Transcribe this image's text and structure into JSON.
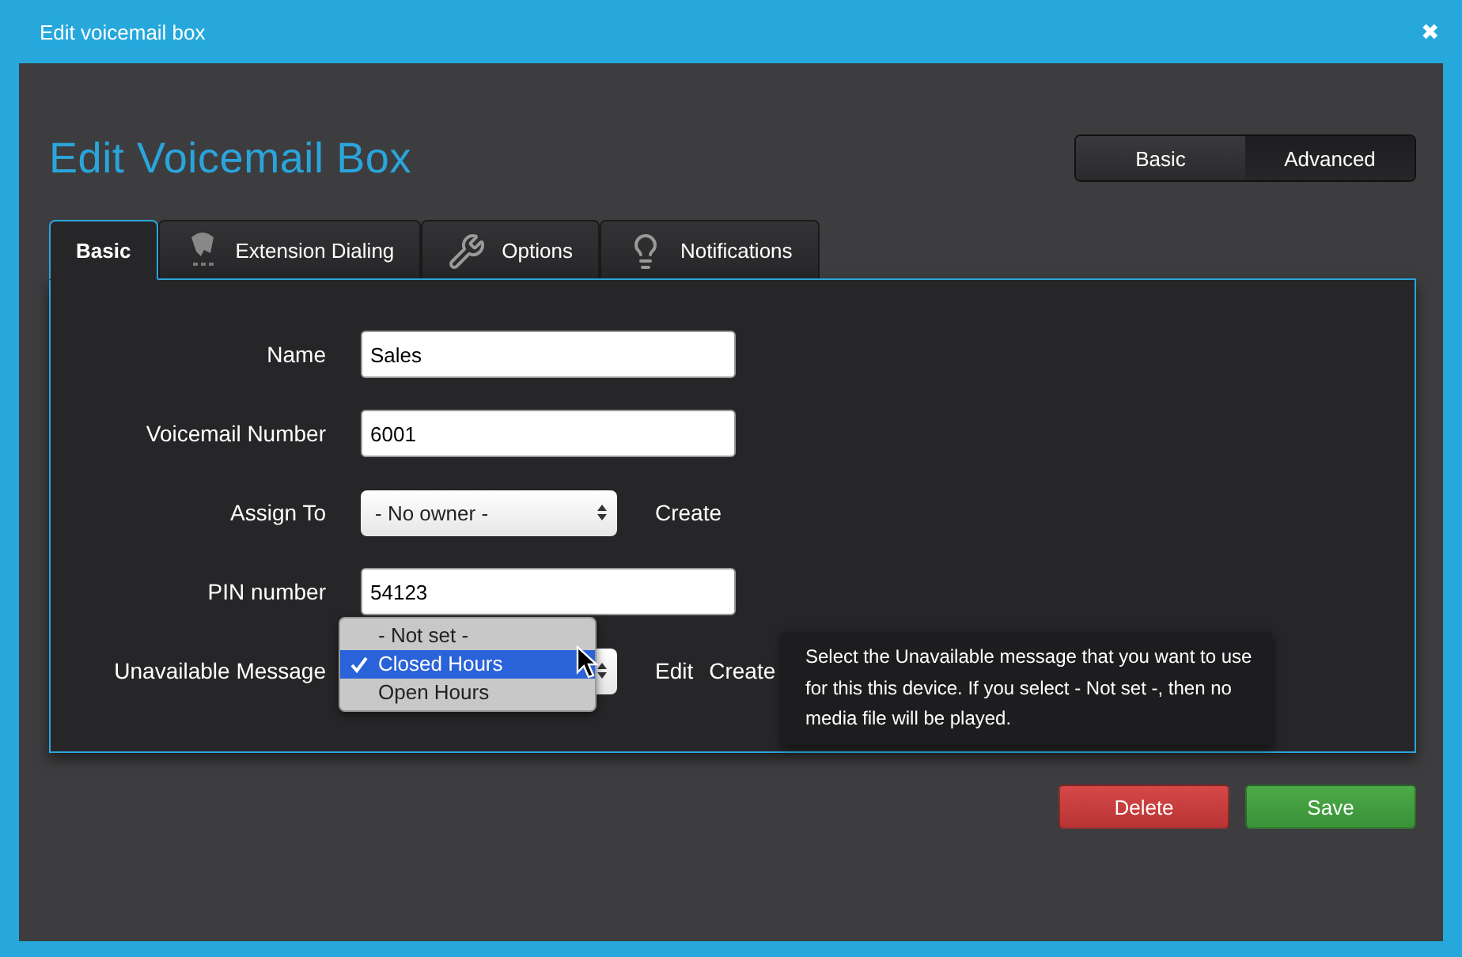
{
  "window": {
    "title": "Edit voicemail box",
    "close": "✖"
  },
  "heading": "Edit Voicemail Box",
  "mode_toggle": [
    {
      "label": "Basic",
      "selected": false
    },
    {
      "label": "Advanced",
      "selected": true
    }
  ],
  "tabs": [
    {
      "label": "Basic",
      "selected": true
    },
    {
      "label": "Extension Dialing",
      "selected": false
    },
    {
      "label": "Options",
      "selected": false
    },
    {
      "label": "Notifications",
      "selected": false
    }
  ],
  "form": [
    {
      "label": "Name",
      "kind": "text",
      "value": "Sales"
    },
    {
      "label": "Voicemail Number",
      "kind": "text",
      "value": "6001"
    },
    {
      "label": "Assign To",
      "kind": "select",
      "expanded": false,
      "value": "- No owner -",
      "links": [
        "Create"
      ]
    },
    {
      "label": "PIN number",
      "kind": "text",
      "value": "54123"
    },
    {
      "label": "Unavailable Message",
      "kind": "select",
      "expanded": true,
      "options": [
        {
          "label": "- Not set -",
          "selected": false
        },
        {
          "label": "Closed Hours",
          "selected": true
        },
        {
          "label": "Open Hours",
          "selected": false
        }
      ],
      "links": [
        "Edit",
        "Create"
      ],
      "tooltip": "Select the Unavailable message that you want to use for this this device. If you select - Not set -, then no media file will be played."
    }
  ],
  "buttons": [
    {
      "label": "Delete",
      "kind": "danger"
    },
    {
      "label": "Save",
      "kind": "primary"
    }
  ]
}
